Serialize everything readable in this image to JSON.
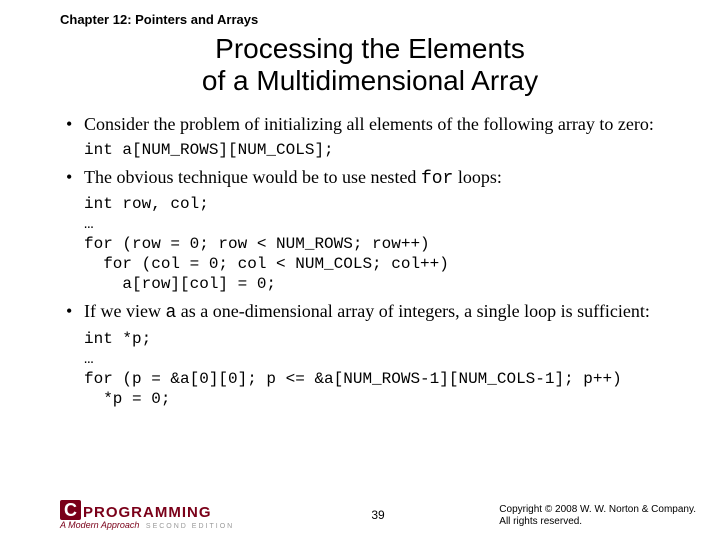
{
  "chapter": "Chapter 12: Pointers and Arrays",
  "title_line1": "Processing the Elements",
  "title_line2": "of a Multidimensional Array",
  "bullet1_pre": "Consider the problem of initializing all elements of the following array to zero:",
  "code1": "int a[NUM_ROWS][NUM_COLS];",
  "bullet2_pre": "The obvious technique would be to use nested ",
  "bullet2_mono": "for",
  "bullet2_post": " loops:",
  "code2": "int row, col;\n…\nfor (row = 0; row < NUM_ROWS; row++)\n  for (col = 0; col < NUM_COLS; col++)\n    a[row][col] = 0;",
  "bullet3_pre": "If we view ",
  "bullet3_mono": "a",
  "bullet3_post": " as a one-dimensional array of integers, a single loop is sufficient:",
  "code3": "int *p;\n…\nfor (p = &a[0][0]; p <= &a[NUM_ROWS-1][NUM_COLS-1]; p++)\n  *p = 0;",
  "logo": {
    "mark": "C",
    "text": "PROGRAMMING",
    "sub": "A Modern Approach",
    "edition": "SECOND EDITION"
  },
  "page": "39",
  "copyright_l1": "Copyright © 2008 W. W. Norton & Company.",
  "copyright_l2": "All rights reserved."
}
